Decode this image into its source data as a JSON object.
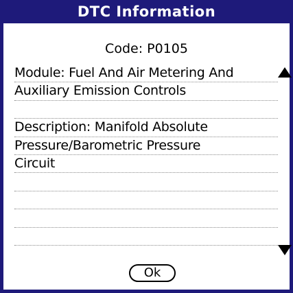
{
  "dialog": {
    "title": "DTC Information",
    "code_line": "Code: P0105",
    "lines": [
      "Module: Fuel And Air Metering And",
      "Auxiliary Emission Controls",
      "",
      "Description: Manifold Absolute",
      "Pressure/Barometric Pressure",
      "Circuit",
      "",
      "",
      "",
      ""
    ],
    "ok_label": "Ok"
  },
  "icons": {
    "scroll_up": "up-triangle",
    "scroll_down": "down-triangle"
  },
  "colors": {
    "title_bar": "#1e1a7a",
    "frame": "#1e1a7a",
    "background": "#ffffff",
    "text": "#000000"
  }
}
